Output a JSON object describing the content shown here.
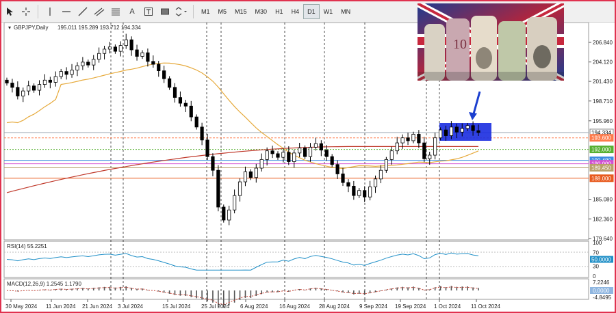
{
  "toolbar": {
    "timeframes": [
      "M1",
      "M5",
      "M15",
      "M30",
      "H1",
      "H4",
      "D1",
      "W1",
      "MN"
    ],
    "active_timeframe": "D1",
    "text_tool_label": "A"
  },
  "chart_header": {
    "symbol": "GBPJPY,Daily",
    "ohlc": "195.011 195.289 193.712 194.334"
  },
  "price_axis": {
    "ticks": [
      "206.840",
      "204.120",
      "201.430",
      "198.710",
      "195.960",
      "194.334",
      "193.600",
      "192.000",
      "190.000",
      "189.450",
      "188.000",
      "185.080",
      "182.360",
      "179.640"
    ],
    "labels": [
      {
        "text": "194.334",
        "color": "#ffffff",
        "value": 194.334
      },
      {
        "text": "193.600",
        "color": "#ff7a4a",
        "value": 193.6
      },
      {
        "text": "192.000",
        "color": "#57b030",
        "value": 192.0
      },
      {
        "text": "190.480",
        "color": "#3d8be0",
        "value": 190.48
      },
      {
        "text": "190.000",
        "color": "#d24fd2",
        "value": 190.0
      },
      {
        "text": "189.450",
        "color": "#b9a06a",
        "value": 189.45
      },
      {
        "text": "188.000",
        "color": "#e85a1e",
        "value": 188.0
      }
    ]
  },
  "rsi": {
    "title": "RSI(14) 55.2251",
    "ticks": [
      "100",
      "70",
      "50.0000",
      "30",
      "0"
    ],
    "current": 55.2251
  },
  "macd": {
    "title": "MACD(12,26,9) 1.2545 1.1790",
    "ticks": [
      "7.2246",
      "0.0000",
      "-4.8495"
    ]
  },
  "date_axis": [
    "30 May 2024",
    "11 Jun 2024",
    "21 Jun 2024",
    "3 Jul 2024",
    "15 Jul 2024",
    "25 Jul 2024",
    "6 Aug 2024",
    "16 Aug 2024",
    "28 Aug 2024",
    "9 Sep 2024",
    "19 Sep 2024",
    "1 Oct 2024",
    "11 Oct 2024"
  ],
  "photo": {
    "caption": "10"
  },
  "colors": {
    "bg": "#ffffff",
    "bull": "#ffffff",
    "bear": "#000000",
    "ma_fast": "#e6a93a",
    "ma_slow": "#c0392b",
    "rsi": "#1f8fc7",
    "box": "#1a2ce0",
    "arrow": "#1b3fcf"
  }
}
